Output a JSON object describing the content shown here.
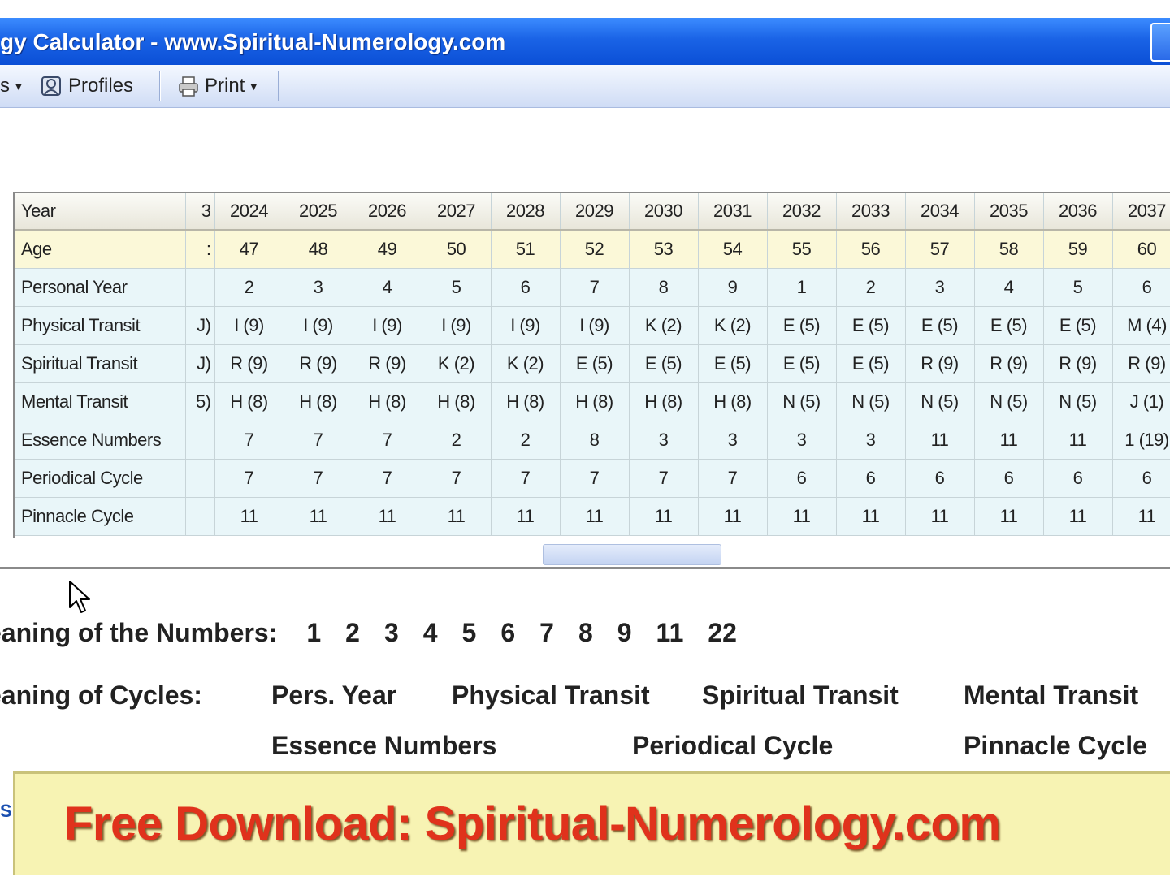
{
  "window": {
    "title": "gy Calculator - www.Spiritual-Numerology.com"
  },
  "toolbar": {
    "partial_item": "s",
    "profiles_label": "Profiles",
    "print_label": "Print"
  },
  "grid": {
    "years": [
      "3",
      "2024",
      "2025",
      "2026",
      "2027",
      "2028",
      "2029",
      "2030",
      "2031",
      "2032",
      "2033",
      "2034",
      "2035",
      "2036",
      "2037"
    ],
    "rows": [
      {
        "label": "Age",
        "values": [
          ":",
          "47",
          "48",
          "49",
          "50",
          "51",
          "52",
          "53",
          "54",
          "55",
          "56",
          "57",
          "58",
          "59",
          "60"
        ]
      },
      {
        "label": "Personal Year",
        "values": [
          "",
          "2",
          "3",
          "4",
          "5",
          "6",
          "7",
          "8",
          "9",
          "1",
          "2",
          "3",
          "4",
          "5",
          "6"
        ]
      },
      {
        "label": "Physical Transit",
        "values": [
          "J)",
          "I (9)",
          "I (9)",
          "I (9)",
          "I (9)",
          "I (9)",
          "I (9)",
          "K (2)",
          "K (2)",
          "E (5)",
          "E (5)",
          "E (5)",
          "E (5)",
          "E (5)",
          "M (4)"
        ]
      },
      {
        "label": "Spiritual Transit",
        "values": [
          "J)",
          "R (9)",
          "R (9)",
          "R (9)",
          "K (2)",
          "K (2)",
          "E (5)",
          "E (5)",
          "E (5)",
          "E (5)",
          "E (5)",
          "R (9)",
          "R (9)",
          "R (9)",
          "R (9)"
        ]
      },
      {
        "label": "Mental Transit",
        "values": [
          "5)",
          "H (8)",
          "H (8)",
          "H (8)",
          "H (8)",
          "H (8)",
          "H (8)",
          "H (8)",
          "H (8)",
          "N (5)",
          "N (5)",
          "N (5)",
          "N (5)",
          "N (5)",
          "J (1)"
        ]
      },
      {
        "label": "Essence Numbers",
        "values": [
          "",
          "7",
          "7",
          "7",
          "2",
          "2",
          "8",
          "3",
          "3",
          "3",
          "3",
          "11",
          "11",
          "11",
          "1 (19)"
        ]
      },
      {
        "label": "Periodical Cycle",
        "values": [
          "",
          "7",
          "7",
          "7",
          "7",
          "7",
          "7",
          "7",
          "7",
          "6",
          "6",
          "6",
          "6",
          "6",
          "6"
        ]
      },
      {
        "label": "Pinnacle Cycle",
        "values": [
          "",
          "11",
          "11",
          "11",
          "11",
          "11",
          "11",
          "11",
          "11",
          "11",
          "11",
          "11",
          "11",
          "11",
          "11"
        ]
      }
    ],
    "header_label": "Year"
  },
  "meanings": {
    "numbers_label": "eaning of the Numbers:",
    "numbers": [
      "1",
      "2",
      "3",
      "4",
      "5",
      "6",
      "7",
      "8",
      "9",
      "11",
      "22"
    ],
    "cycles_label": "eaning of Cycles:",
    "cycles": {
      "pers_year": "Pers. Year",
      "physical": "Physical Transit",
      "spiritual": "Spiritual Transit",
      "mental": "Mental Transit",
      "essence": "Essence Numbers",
      "periodical": "Periodical Cycle",
      "pinnacle": "Pinnacle Cycle"
    }
  },
  "status": {
    "partial": "S"
  },
  "banner": {
    "text": "Free Download: Spiritual-Numerology.com"
  }
}
